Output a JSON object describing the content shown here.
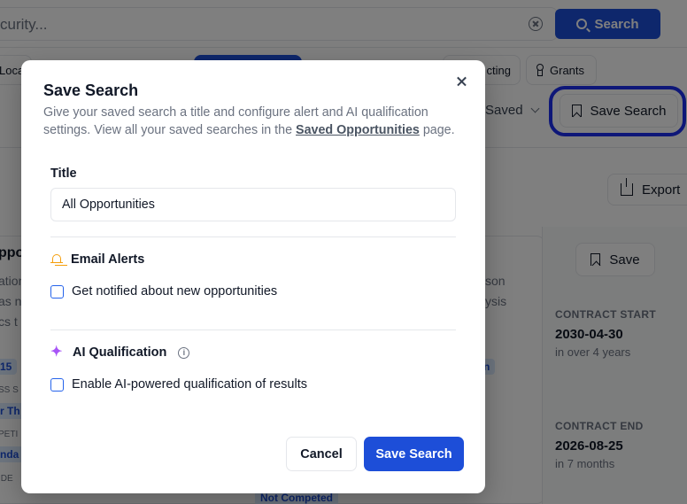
{
  "background": {
    "search": {
      "text": "curity...",
      "button_label": "Search"
    },
    "chips": [
      {
        "label": "Loca"
      },
      {
        "label": ""
      },
      {
        "label": "cting"
      },
      {
        "label": "Grants"
      }
    ],
    "sort_dropdown": "Saved",
    "save_search_button": "Save Search",
    "export_button": "Export",
    "save_button": "Save",
    "card_snippets": [
      "ppor",
      "ation",
      "as n",
      "cs t",
      "son",
      "ysis"
    ],
    "tags": [
      "15",
      "r Th",
      "nda",
      "Not Competed",
      "n"
    ],
    "small_labels": [
      "SS S",
      "PETI",
      "IDE"
    ],
    "meta": [
      {
        "label": "CONTRACT START",
        "value": "2030-04-30",
        "sub": "in over 4 years"
      },
      {
        "label": "CONTRACT END",
        "value": "2026-08-25",
        "sub": "in 7 months"
      }
    ]
  },
  "modal": {
    "title": "Save Search",
    "description_prefix": "Give your saved search a title and configure alert and AI qualification settings. View all your saved searches in the ",
    "description_link": "Saved Opportunities",
    "description_suffix": " page.",
    "title_label": "Title",
    "title_value": "All Opportunities",
    "email_alerts": {
      "heading": "Email Alerts",
      "checkbox_label": "Get notified about new opportunities",
      "checked": false
    },
    "ai_qualification": {
      "heading": "AI Qualification",
      "checkbox_label": "Enable AI-powered qualification of results",
      "checked": false
    },
    "cancel_label": "Cancel",
    "save_label": "Save Search"
  },
  "colors": {
    "primary": "#1d4ed8",
    "highlight_ring": "#1d2ff0",
    "bell": "#f59e0b",
    "sparkle": "#a855f7"
  }
}
